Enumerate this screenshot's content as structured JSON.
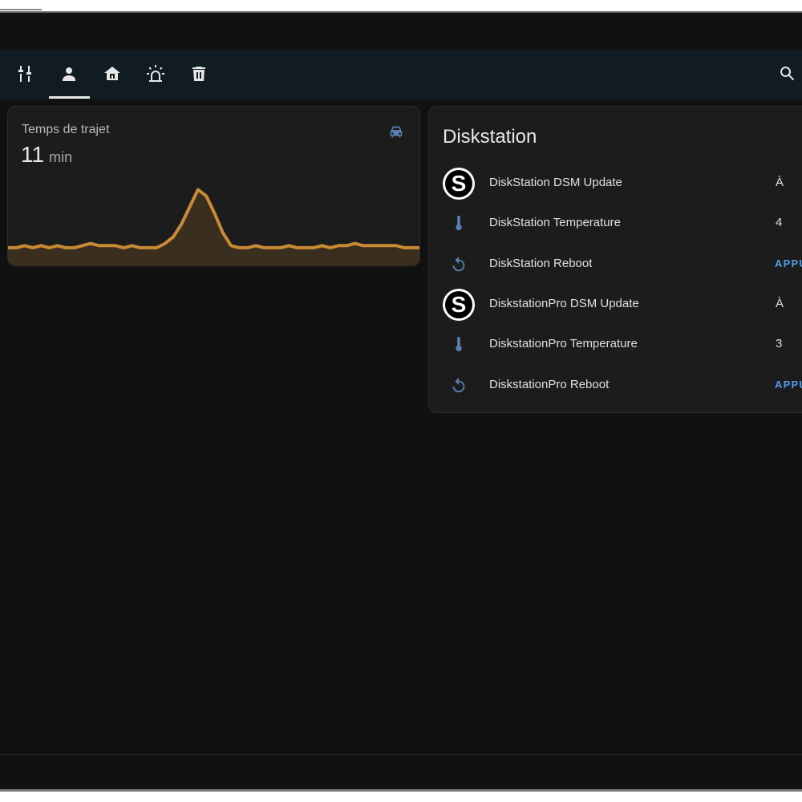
{
  "toolbar": {
    "icons": [
      "tuner-icon",
      "person-icon",
      "home-icon",
      "alarm-light-icon",
      "trash-icon"
    ],
    "active_tab": 1
  },
  "travel_card": {
    "name": "Temps de trajet",
    "value": "11",
    "unit": "min",
    "icon": "car-icon",
    "line_color": "#c98a35",
    "fill_color": "#3a2e1f",
    "series": [
      11,
      11,
      12,
      11,
      12,
      11,
      12,
      11,
      11,
      12,
      13,
      12,
      12,
      12,
      11,
      12,
      11,
      11,
      11,
      13,
      16,
      22,
      30,
      38,
      35,
      27,
      18,
      12,
      11,
      11,
      12,
      11,
      11,
      11,
      12,
      11,
      11,
      11,
      12,
      11,
      12,
      12,
      13,
      12,
      12,
      12,
      12,
      12,
      11,
      11,
      11
    ]
  },
  "disk_card": {
    "title": "Diskstation",
    "rows": [
      {
        "icon": "synology-logo",
        "name": "DiskStation DSM Update",
        "state": "À",
        "action": ""
      },
      {
        "icon": "thermometer-icon",
        "name": "DiskStation Temperature",
        "state": "4",
        "action": ""
      },
      {
        "icon": "restart-icon",
        "name": "DiskStation Reboot",
        "state": "",
        "action": "APPU"
      },
      {
        "icon": "synology-logo",
        "name": "DiskstationPro DSM Update",
        "state": "À",
        "action": ""
      },
      {
        "icon": "thermometer-icon",
        "name": "DiskstationPro Temperature",
        "state": "3",
        "action": ""
      },
      {
        "icon": "restart-icon",
        "name": "DiskstationPro Reboot",
        "state": "",
        "action": "APPU"
      }
    ],
    "logo_letter": "S"
  },
  "colors": {
    "background": "#111111",
    "toolbar": "#101b22",
    "card": "#1c1c1c",
    "icon_blue": "#5a7fb4",
    "action_blue": "#4d9ee8"
  }
}
